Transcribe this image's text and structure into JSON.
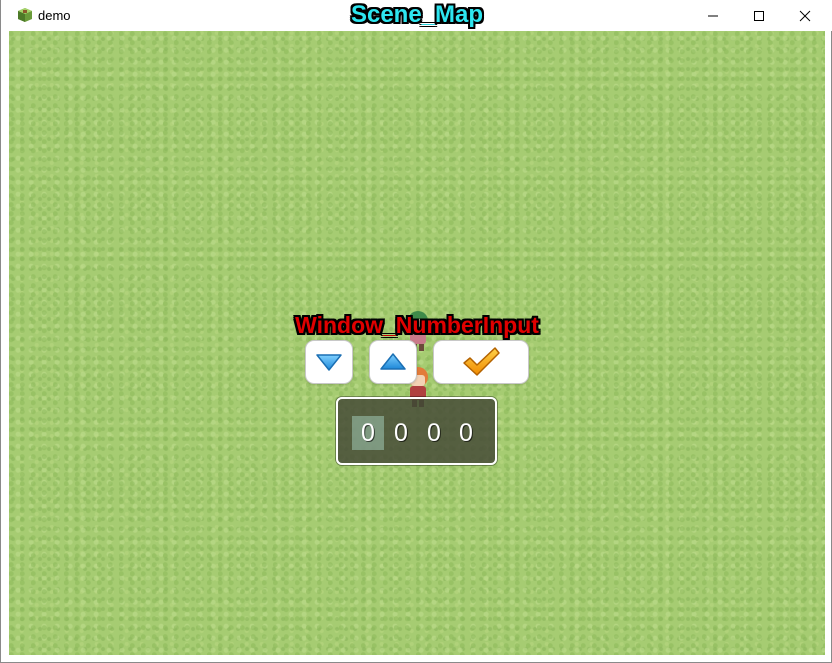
{
  "window": {
    "app_title": "demo",
    "scene_label": "Scene_Map",
    "controls": {
      "minimize_icon": "minimize-icon",
      "maximize_icon": "maximize-icon",
      "close_icon": "close-icon"
    }
  },
  "game": {
    "map_color": "#a6cc72",
    "window_label": "Window_NumberInput",
    "buttons": {
      "down_icon": "triangle-down-icon",
      "up_icon": "triangle-up-icon",
      "ok_icon": "checkmark-icon"
    },
    "number_input": {
      "digits": [
        "0",
        "0",
        "0",
        "0"
      ],
      "selected_index": 0
    },
    "colors": {
      "scene_label": "#2ee6f0",
      "window_label": "#e00000",
      "arrow_blue": "#2ea6ec",
      "check_orange": "#f5a000"
    }
  }
}
